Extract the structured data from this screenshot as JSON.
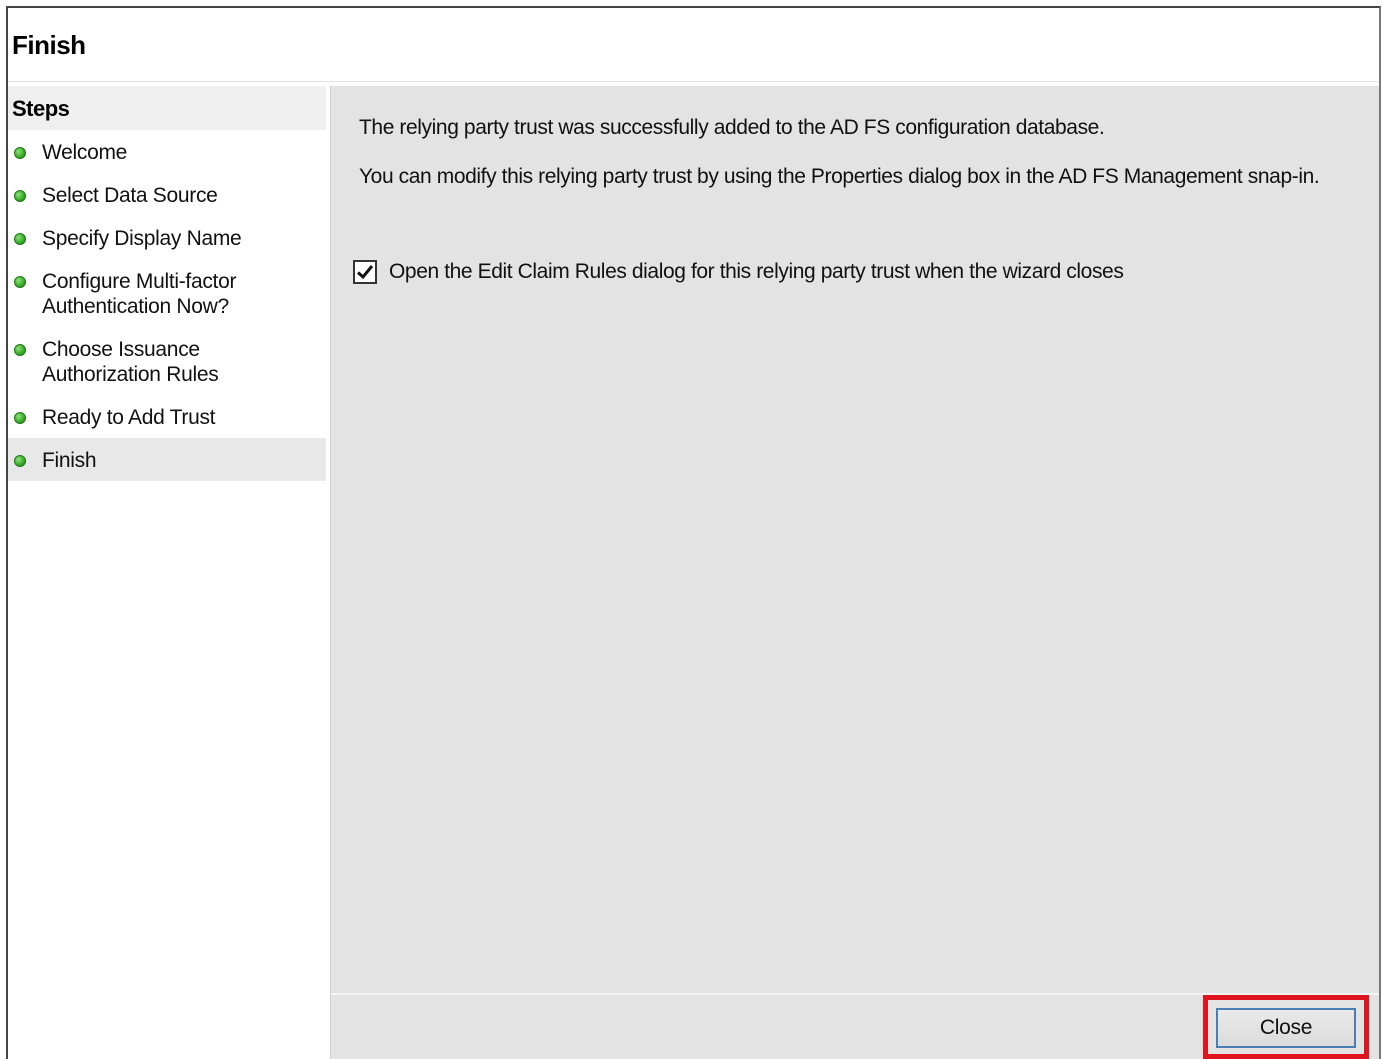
{
  "header": {
    "title": "Finish"
  },
  "sidebar": {
    "heading": "Steps",
    "items": [
      {
        "label": "Welcome",
        "status": "complete"
      },
      {
        "label": "Select Data Source",
        "status": "complete"
      },
      {
        "label": "Specify Display Name",
        "status": "complete"
      },
      {
        "label": "Configure Multi-factor Authentication Now?",
        "status": "complete"
      },
      {
        "label": "Choose Issuance Authorization Rules",
        "status": "complete"
      },
      {
        "label": "Ready to Add Trust",
        "status": "complete"
      },
      {
        "label": "Finish",
        "status": "current"
      }
    ]
  },
  "main": {
    "message_success": "The relying party trust was successfully added to the AD FS configuration database.",
    "message_modify": "You can modify this relying party trust by using the Properties dialog box in the AD FS Management snap-in.",
    "checkbox": {
      "label": "Open the Edit Claim Rules dialog for this relying party trust when the wizard closes",
      "checked": true
    }
  },
  "footer": {
    "close_label": "Close"
  },
  "colors": {
    "status_dot": "#3bb02a",
    "highlight": "#e0141e",
    "content_bg": "#e3e3e3"
  },
  "icons": {
    "step_status": "green-dot-icon",
    "checkbox": "checkmark-icon"
  }
}
